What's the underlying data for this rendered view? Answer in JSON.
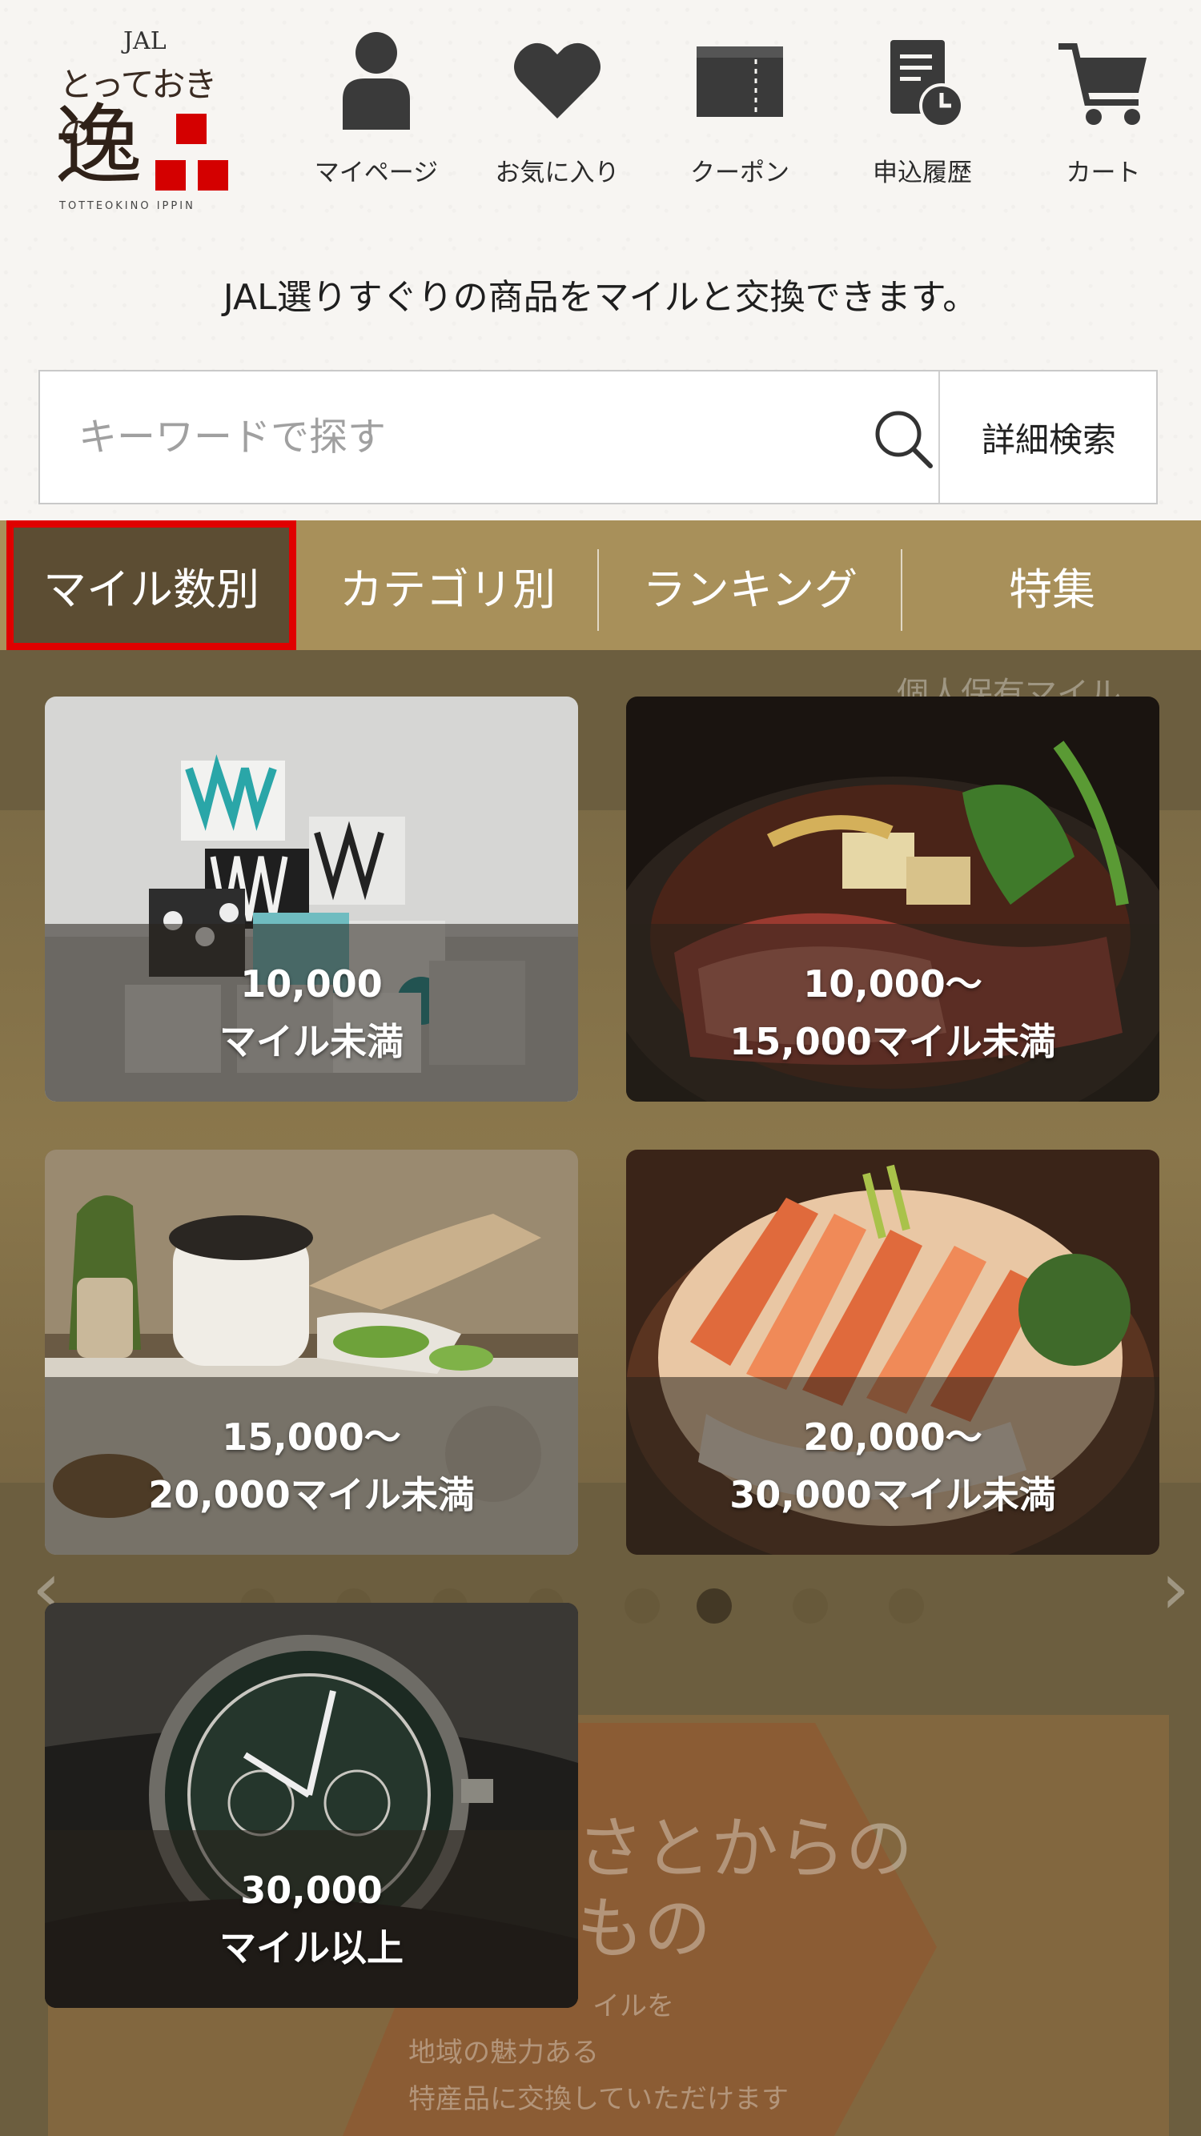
{
  "header": {
    "logo": {
      "top": "JAL",
      "brand": "とっておきの",
      "kanji": "逸",
      "romaji": "TOTTEOKINO IPPIN"
    },
    "nav": [
      {
        "label": "マイページ",
        "icon": "person-icon"
      },
      {
        "label": "お気に入り",
        "icon": "heart-icon"
      },
      {
        "label": "クーポン",
        "icon": "coupon-icon"
      },
      {
        "label": "申込履歴",
        "icon": "history-icon"
      },
      {
        "label": "カート",
        "icon": "cart-icon"
      }
    ],
    "tagline": "JAL選りすぐりの商品をマイルと交換できます。"
  },
  "search": {
    "placeholder": "キーワードで探す",
    "advanced_label": "詳細検索"
  },
  "tabs": [
    {
      "label": "マイル数別",
      "active": true
    },
    {
      "label": "カテゴリ別",
      "active": false
    },
    {
      "label": "ランキング",
      "active": false
    },
    {
      "label": "特集",
      "active": false
    }
  ],
  "mile_ranges": [
    {
      "line1": "10,000",
      "line2": "マイル未満"
    },
    {
      "line1": "10,000～",
      "line2": "15,000マイル未満"
    },
    {
      "line1": "15,000～",
      "line2": "20,000マイル未満"
    },
    {
      "line1": "20,000～",
      "line2": "30,000マイル未満"
    },
    {
      "line1": "30,000",
      "line2": "マイル以上"
    }
  ],
  "background_banner": {
    "text_a": "個人保有マイル",
    "text_b": "さとからの",
    "text_c": "もの",
    "text_d": "イルを",
    "text_e": "地域の魅力ある",
    "text_f": "特産品に交換していただけます"
  },
  "colors": {
    "tab_bar": "#a8905a",
    "tab_active": "#5c4d33",
    "highlight_border": "#e00000",
    "content_bg": "#6c5e3f",
    "logo_red": "#d40000"
  }
}
